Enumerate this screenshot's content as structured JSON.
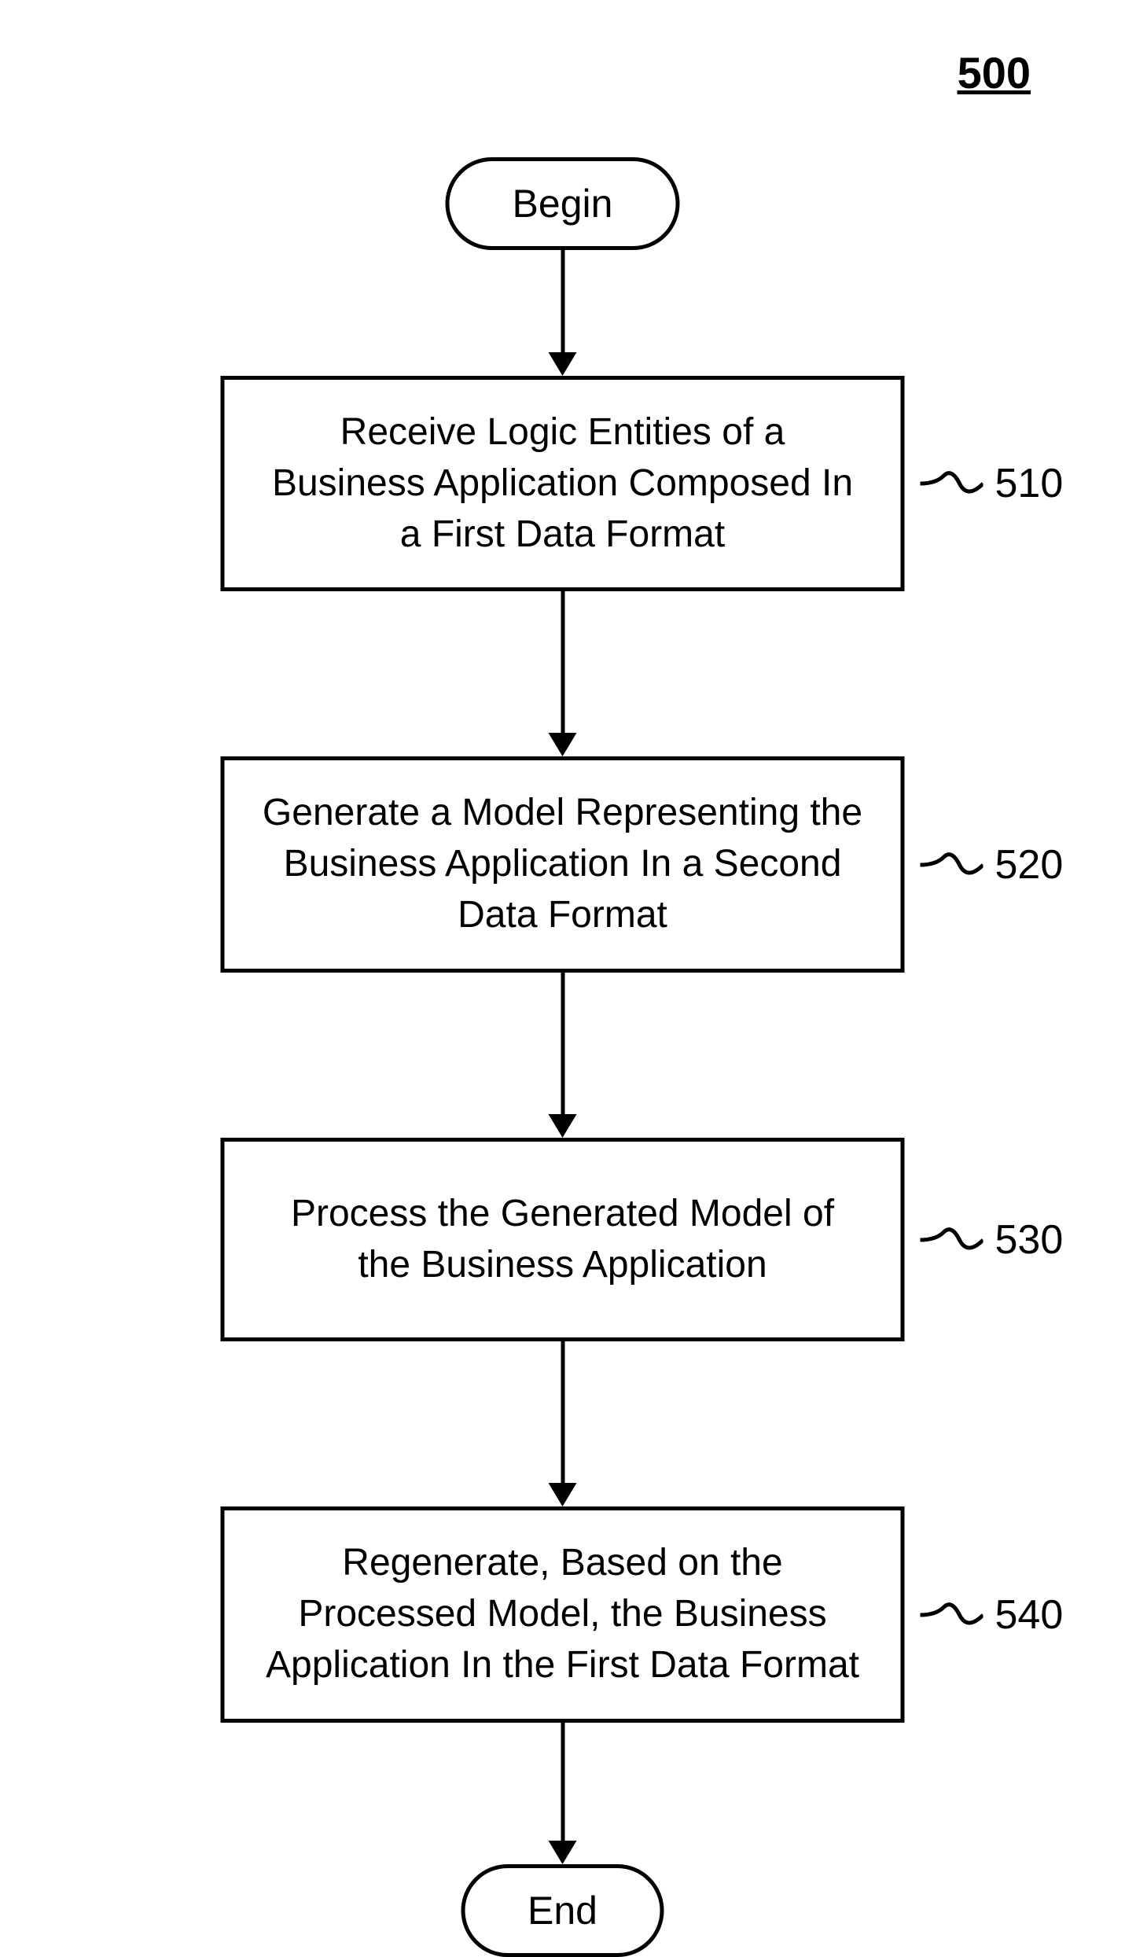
{
  "figure_number": "500",
  "terminators": {
    "begin": "Begin",
    "end": "End"
  },
  "steps": [
    {
      "text": "Receive Logic Entities of a Business Application Composed In a First Data Format",
      "label": "510"
    },
    {
      "text": "Generate a Model Representing the Business Application In a Second Data Format",
      "label": "520"
    },
    {
      "text": "Process the Generated Model of the Business Application",
      "label": "530"
    },
    {
      "text": "Regenerate, Based on the Processed Model, the Business Application In the First Data Format",
      "label": "540"
    }
  ],
  "chart_data": {
    "type": "flowchart",
    "title": "500",
    "nodes": [
      {
        "id": "begin",
        "type": "terminator",
        "label": "Begin"
      },
      {
        "id": "510",
        "type": "process",
        "label": "Receive Logic Entities of a Business Application Composed In a First Data Format"
      },
      {
        "id": "520",
        "type": "process",
        "label": "Generate a Model Representing the Business Application In a Second Data Format"
      },
      {
        "id": "530",
        "type": "process",
        "label": "Process the Generated Model of the Business Application"
      },
      {
        "id": "540",
        "type": "process",
        "label": "Regenerate, Based on the Processed Model, the Business Application In the First Data Format"
      },
      {
        "id": "end",
        "type": "terminator",
        "label": "End"
      }
    ],
    "edges": [
      {
        "from": "begin",
        "to": "510"
      },
      {
        "from": "510",
        "to": "520"
      },
      {
        "from": "520",
        "to": "530"
      },
      {
        "from": "530",
        "to": "540"
      },
      {
        "from": "540",
        "to": "end"
      }
    ]
  }
}
